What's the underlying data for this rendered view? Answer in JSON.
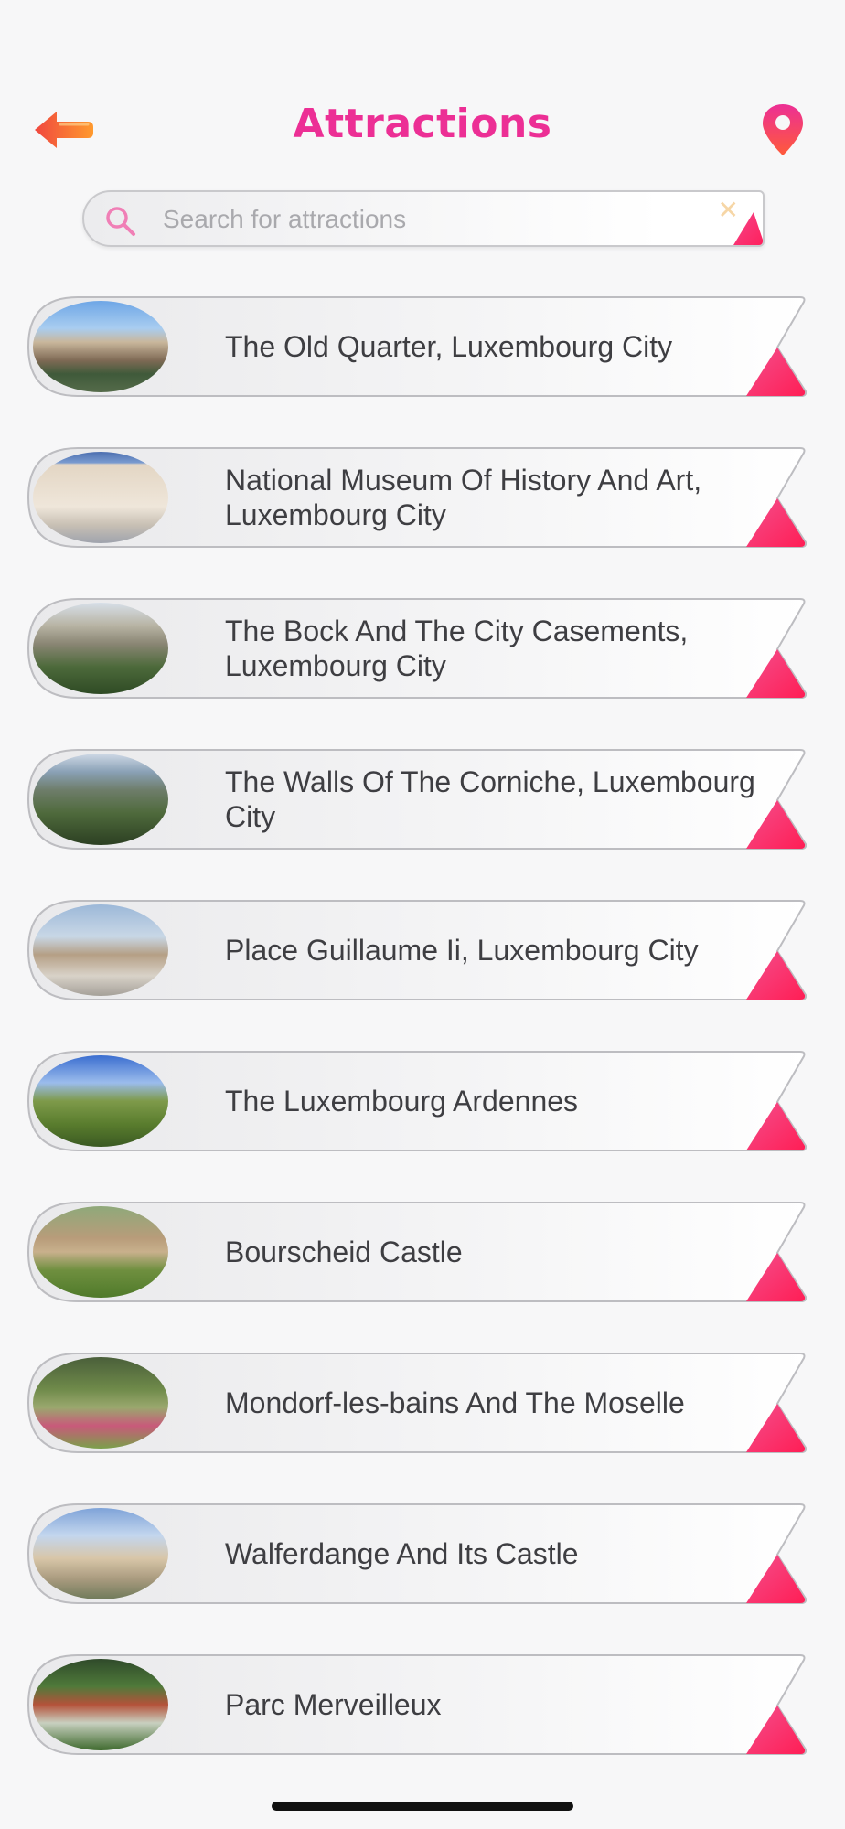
{
  "header": {
    "title": "Attractions",
    "back_icon": "back-arrow-icon",
    "map_icon": "map-pin-icon"
  },
  "search": {
    "placeholder": "Search for attractions",
    "value": "",
    "icon": "search-icon",
    "clear_icon": "close-icon"
  },
  "colors": {
    "accent": "#ec2f95",
    "accent_orange": "#ff6a3d",
    "background": "#f7f7f8"
  },
  "attractions": [
    {
      "label": "The Old Quarter, Luxembourg City",
      "thumb_icon": "old-quarter-photo"
    },
    {
      "label": "National Museum Of History And Art, Luxembourg City",
      "thumb_icon": "museum-photo"
    },
    {
      "label": "The Bock And The City Casements, Luxembourg City",
      "thumb_icon": "bock-casements-photo"
    },
    {
      "label": "The Walls Of The Corniche, Luxembourg City",
      "thumb_icon": "corniche-walls-photo"
    },
    {
      "label": "Place Guillaume Ii, Luxembourg City",
      "thumb_icon": "place-guillaume-photo"
    },
    {
      "label": "The Luxembourg Ardennes",
      "thumb_icon": "ardennes-photo"
    },
    {
      "label": "Bourscheid Castle",
      "thumb_icon": "bourscheid-castle-photo"
    },
    {
      "label": "Mondorf-les-bains And The Moselle",
      "thumb_icon": "mondorf-photo"
    },
    {
      "label": "Walferdange And Its Castle",
      "thumb_icon": "walferdange-castle-photo"
    },
    {
      "label": "Parc Merveilleux",
      "thumb_icon": "parc-merveilleux-photo"
    }
  ]
}
